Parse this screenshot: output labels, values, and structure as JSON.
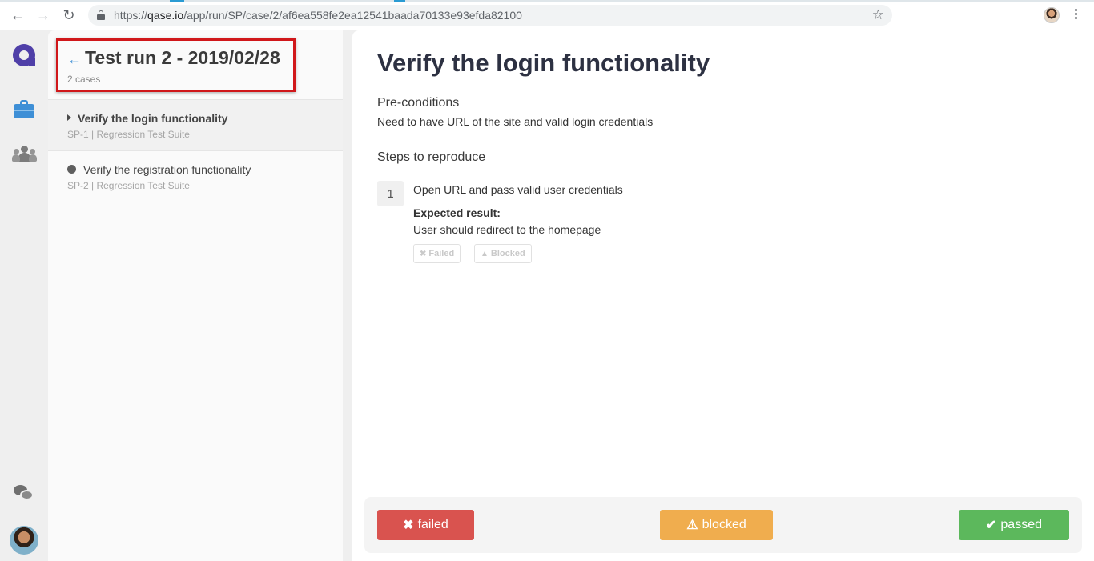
{
  "browser": {
    "url_scheme": "https://",
    "url_host": "qase.io",
    "url_path": "/app/run/SP/case/2/af6ea558fe2ea12541baada70133e93efda82100",
    "back_icon": "←",
    "forward_icon": "→",
    "reload_icon": "↻",
    "star_icon": "☆"
  },
  "run": {
    "back_icon": "←",
    "title": "Test run 2 - 2019/02/28",
    "subtitle": "2 cases"
  },
  "cases": [
    {
      "title": "Verify the login functionality",
      "meta": "SP-1 | Regression Test Suite"
    },
    {
      "title": "Verify the registration functionality",
      "meta": "SP-2 | Regression Test Suite"
    }
  ],
  "detail": {
    "title": "Verify the login functionality",
    "preconditions_label": "Pre-conditions",
    "preconditions_text": "Need to have URL of the site and valid login credentials",
    "steps_label": "Steps to reproduce",
    "steps": [
      {
        "number": "1",
        "action": "Open URL and pass valid user credentials",
        "expected_label": "Expected result:",
        "expected_text": "User should redirect to the homepage",
        "failed_label": "Failed",
        "failed_icon": "✖",
        "blocked_label": "Blocked",
        "blocked_icon": "▲"
      }
    ]
  },
  "actions": {
    "failed_label": "failed",
    "failed_icon": "✖",
    "blocked_label": "blocked",
    "blocked_icon": "⚠",
    "passed_label": "passed",
    "passed_icon": "✔"
  },
  "colors": {
    "accent": "#3e8fd6",
    "failed": "#d9534f",
    "blocked": "#f0ad4e",
    "passed": "#5cb85c",
    "highlight": "#d0171a"
  }
}
